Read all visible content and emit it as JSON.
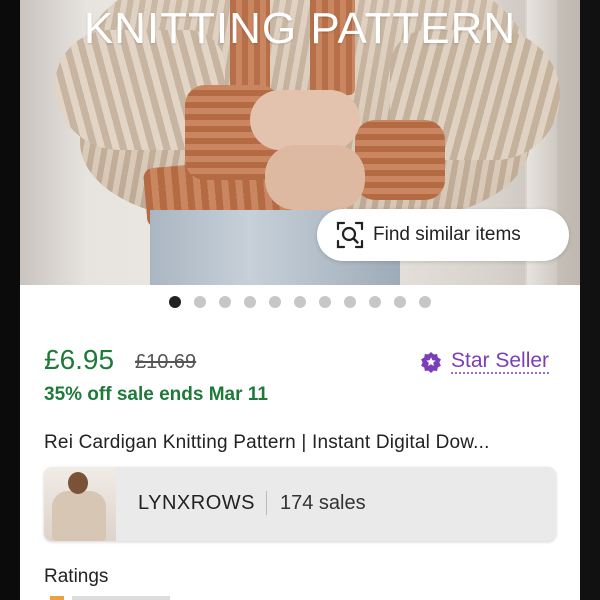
{
  "hero": {
    "title": "KNITTING PATTERN",
    "find_similar_label": "Find similar items",
    "image_count": 11,
    "active_index": 0
  },
  "listing": {
    "price": "£6.95",
    "original_price": "£10.69",
    "sale_note": "35% off sale ends Mar 11",
    "star_seller_label": "Star Seller",
    "title": "Rei Cardigan Knitting Pattern | Instant Digital Dow..."
  },
  "shop": {
    "name": "LYNXROWS",
    "sales": "174 sales"
  },
  "ratings": {
    "heading": "Ratings"
  },
  "colors": {
    "price_green": "#1f7a3a",
    "star_seller_purple": "#7a3fb8",
    "accent_rust": "#b66f48"
  },
  "icons": [
    "visual-search-icon",
    "star-seller-badge-icon"
  ]
}
